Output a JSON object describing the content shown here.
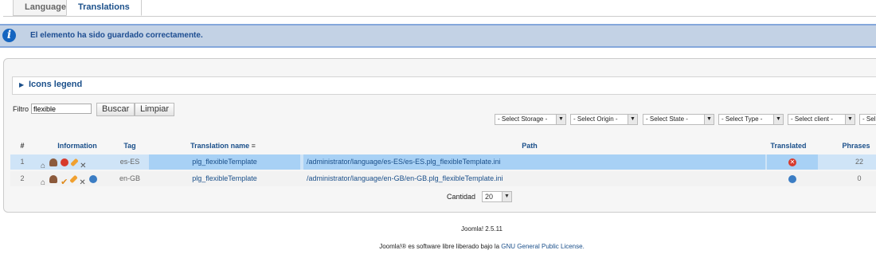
{
  "tabs": [
    {
      "label": "Languages",
      "active": false
    },
    {
      "label": "Translations",
      "active": true
    }
  ],
  "message": {
    "text": "El elemento ha sido guardado correctamente."
  },
  "legend": {
    "label": "Icons legend"
  },
  "filter": {
    "label": "Filtro",
    "value": "flexible",
    "search_button": "Buscar",
    "clear_button": "Limpiar"
  },
  "selects": [
    "- Select Storage -",
    "- Select Origin -",
    "- Select State -",
    "- Select Type -",
    "- Select client -",
    "- Sel"
  ],
  "table": {
    "headers": [
      "#",
      "Information",
      "Tag",
      "Translation name",
      "Path",
      "Translated",
      "Phrases"
    ],
    "rows": [
      {
        "num": "1",
        "tag": "es-ES",
        "name": "plg_flexibleTemplate",
        "path": "/administrator/language/es-ES/es-ES.plg_flexibleTemplate.ini",
        "translated_icon": "error-icon",
        "phrases": "22"
      },
      {
        "num": "2",
        "tag": "en-GB",
        "name": "plg_flexibleTemplate",
        "path": "/administrator/language/en-GB/en-GB.plg_flexibleTemplate.ini",
        "translated_icon": "gear-icon",
        "phrases": "0"
      }
    ]
  },
  "pagination": {
    "label": "Cantidad",
    "value": "20"
  },
  "footer": {
    "version": "Joomla! 2.5.11",
    "license_prefix": "Joomla!® es software libre liberado bajo la",
    "license_link": "GNU General Public License."
  },
  "colors": {
    "accent": "#1a4f8a",
    "message_bg": "#c3d2e5",
    "row_selected": "#cfe4f7"
  }
}
